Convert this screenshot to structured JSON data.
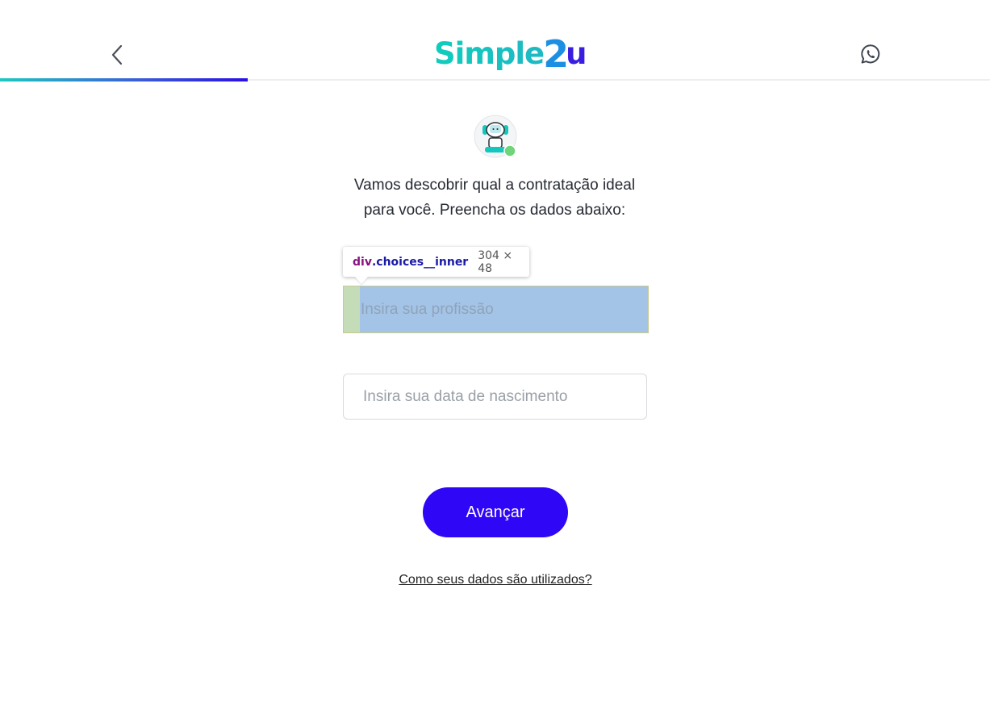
{
  "header": {
    "logo_text_simple": "Simple",
    "logo_text_2": "2",
    "logo_text_u": "u",
    "back_icon": "chevron-left-icon",
    "whatsapp_icon": "whatsapp-icon",
    "progress": 0.25
  },
  "main": {
    "intro_line1": "Vamos descobrir qual a contratação ideal",
    "intro_line2": "para você. Preencha os dados abaixo:",
    "profession_placeholder": "Insira sua profissão",
    "birthdate_placeholder": "Insira sua data de nascimento",
    "submit_label": "Avançar",
    "data_link": "Como seus dados são utilizados?"
  },
  "devtools_tooltip": {
    "tag": "div",
    "class_name": ".choices__inner",
    "dimensions": "304 × 48"
  },
  "colors": {
    "brand_primary": "#2f06f5",
    "brand_teal": "#13c7bd",
    "brand_blue": "#1d8fe2"
  }
}
